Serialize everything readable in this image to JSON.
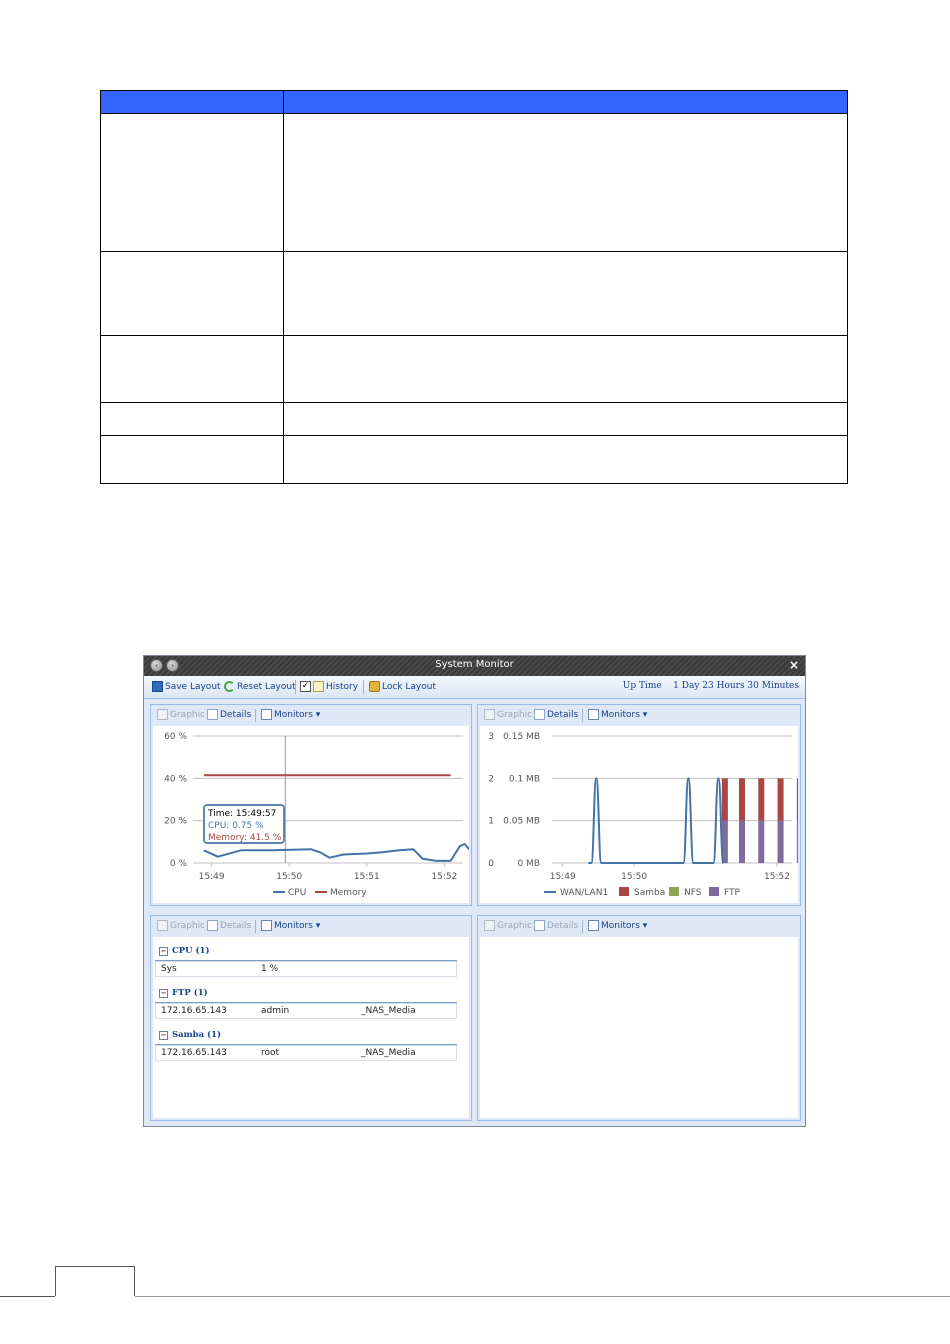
{
  "window": {
    "title": "System Monitor",
    "close_glyph": "×",
    "nav_back_glyph": "‹",
    "nav_fwd_glyph": "›"
  },
  "toolbar": {
    "save_layout": "Save Layout",
    "reset_layout": "Reset Layout",
    "history_checked": "✓",
    "history": "History",
    "lock_layout": "Lock Layout",
    "uptime_label": "Up Time",
    "uptime_value": "1 Day 23 Hours 30 Minutes"
  },
  "panel_toolbar": {
    "graphic": "Graphic",
    "details": "Details",
    "monitors": "Monitors ▾"
  },
  "icons": {
    "save": "save-icon",
    "reset": "refresh-icon",
    "history": "history-icon",
    "lock": "lock-icon",
    "graphic": "chart-icon",
    "details": "table-icon",
    "monitors": "monitor-icon"
  },
  "tooltip": {
    "time": "Time: 15:49:57",
    "cpu": "CPU: 0.75 %",
    "memory": "Memory: 41.5 %"
  },
  "details": {
    "groups": [
      {
        "title": "CPU (1)",
        "rows": [
          [
            "Sys",
            "1 %",
            ""
          ]
        ]
      },
      {
        "title": "FTP (1)",
        "rows": [
          [
            "172.16.65.143",
            "admin",
            "_NAS_Media"
          ]
        ]
      },
      {
        "title": "Samba (1)",
        "rows": [
          [
            "172.16.65.143",
            "root",
            "_NAS_Media"
          ]
        ]
      }
    ]
  },
  "chart_data": [
    {
      "type": "line",
      "yticks": [
        "60 %",
        "40 %",
        "20 %",
        "0 %"
      ],
      "xticks": [
        "15:49",
        "15:50",
        "15:51",
        "15:52"
      ],
      "ylim": [
        0,
        60
      ],
      "grid": true,
      "legend": "bottom",
      "colors": {
        "CPU": "#4572a7",
        "Memory": "#aa4643"
      },
      "series": [
        {
          "name": "Memory",
          "points": [
            [
              15.815,
              41.5
            ],
            [
              15.868,
              41.5
            ]
          ]
        },
        {
          "name": "CPU",
          "points": [
            [
              15.815,
              6
            ],
            [
              15.818,
              3
            ],
            [
              15.823,
              6
            ],
            [
              15.83,
              6
            ],
            [
              15.838,
              6.5
            ],
            [
              15.84,
              5
            ],
            [
              15.842,
              2.5
            ],
            [
              15.845,
              4
            ],
            [
              15.85,
              4.5
            ],
            [
              15.853,
              5
            ],
            [
              15.857,
              6
            ],
            [
              15.86,
              6.5
            ],
            [
              15.862,
              2
            ],
            [
              15.865,
              1
            ],
            [
              15.868,
              1
            ],
            [
              15.87,
              8
            ],
            [
              15.871,
              9
            ],
            [
              15.873,
              4
            ],
            [
              15.874,
              1
            ]
          ]
        }
      ]
    },
    {
      "type": "bar",
      "yticks_left": [
        "3",
        "2",
        "1",
        "0"
      ],
      "yticks_right": [
        "0.15 MB",
        "0.1 MB",
        "0.05 MB",
        "0 MB"
      ],
      "xticks": [
        "15:49",
        "15:50",
        "15:52"
      ],
      "ylim": [
        0,
        3
      ],
      "grid": true,
      "legend": "bottom",
      "colors": {
        "WAN/LAN1": "#4572a7",
        "Samba": "#aa4643",
        "NFS": "#89a54e",
        "FTP": "#80699b"
      },
      "series_names": [
        "WAN/LAN1",
        "Samba",
        "NFS",
        "FTP"
      ],
      "wan_peaks": [
        15.8245,
        15.846,
        15.853
      ],
      "bars": [
        {
          "t": 15.8545,
          "ftp": 1,
          "samba": 1
        },
        {
          "t": 15.8585,
          "ftp": 1,
          "samba": 1
        },
        {
          "t": 15.863,
          "ftp": 1,
          "samba": 1
        },
        {
          "t": 15.8675,
          "ftp": 1,
          "samba": 1
        },
        {
          "t": 15.872,
          "ftp": 1,
          "samba": 1
        },
        {
          "t": 15.8795,
          "ftp": 1,
          "samba": 1
        },
        {
          "t": 15.884,
          "ftp": 1,
          "samba": 1
        },
        {
          "t": 15.8885,
          "ftp": 1,
          "samba": 1
        }
      ]
    }
  ]
}
